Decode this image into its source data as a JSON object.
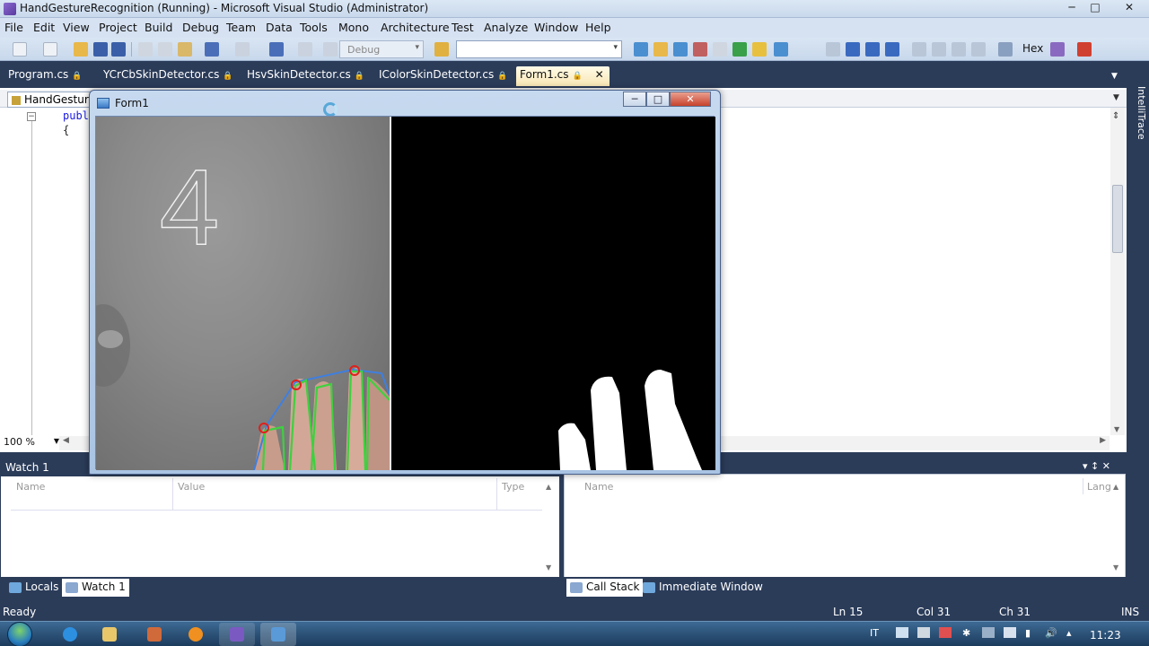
{
  "window": {
    "title": "HandGestureRecognition (Running) - Microsoft Visual Studio (Administrator)",
    "minimize": "─",
    "maximize": "□",
    "close": "✕"
  },
  "menu": [
    "File",
    "Edit",
    "View",
    "Project",
    "Build",
    "Debug",
    "Team",
    "Data",
    "Tools",
    "Mono",
    "Architecture",
    "Test",
    "Analyze",
    "Window",
    "Help"
  ],
  "toolbar": {
    "configuration": "Debug",
    "search_value": "",
    "hex_label": "Hex"
  },
  "tabs": [
    {
      "label": "Program.cs",
      "locked": true,
      "active": false
    },
    {
      "label": "YCrCbSkinDetector.cs",
      "locked": true,
      "active": false
    },
    {
      "label": "HsvSkinDetector.cs",
      "locked": true,
      "active": false
    },
    {
      "label": "IColorSkinDetector.cs",
      "locked": true,
      "active": false
    },
    {
      "label": "Form1.cs",
      "locked": true,
      "active": true
    }
  ],
  "editor": {
    "class_dropdown": "HandGesture",
    "code_lines": [
      "publ",
      "{"
    ],
    "zoom": "100 %",
    "side_panel": "IntelliTrace"
  },
  "form1": {
    "title": "Form1",
    "finger_count": "4",
    "minimize": "─",
    "maximize": "□",
    "close": "✕"
  },
  "watch": {
    "title": "Watch 1",
    "columns": [
      "Name",
      "Value",
      "Type"
    ]
  },
  "callstack": {
    "columns": [
      "Name",
      "Lang"
    ]
  },
  "pane_tabs_left": [
    {
      "label": "Locals",
      "active": false
    },
    {
      "label": "Watch 1",
      "active": true
    }
  ],
  "pane_tabs_right": [
    {
      "label": "Call Stack",
      "active": true
    },
    {
      "label": "Immediate Window",
      "active": false
    }
  ],
  "pane_controls": {
    "pin": "▾ ↕ ✕"
  },
  "status": {
    "text": "Ready",
    "line": "Ln 15",
    "col": "Col 31",
    "ch": "Ch 31",
    "mode": "INS"
  },
  "taskbar": {
    "language": "IT",
    "time": "11:23"
  },
  "colors": {
    "ide_background": "#2b3c59",
    "active_tab": "#f8e6b4",
    "fingertip_marker": "#e0201c",
    "contour": "#3fd03f",
    "hull": "#3f7fe0"
  }
}
